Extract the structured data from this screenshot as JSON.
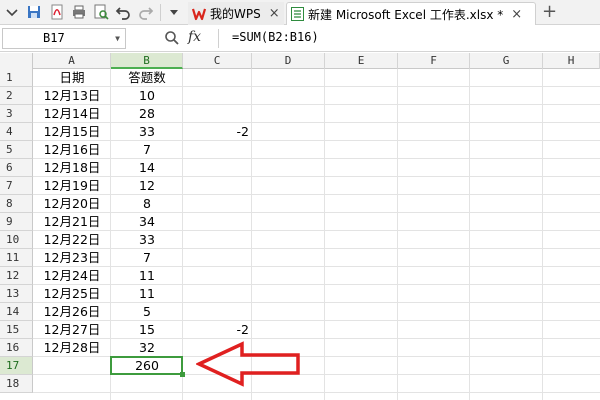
{
  "toolbar": {
    "icons": [
      "app-menu-icon",
      "save-icon",
      "pdf-export-icon",
      "print-icon",
      "print-preview-icon",
      "undo-icon",
      "redo-icon",
      "more-dropdown-icon"
    ]
  },
  "tabs": [
    {
      "label": "我的WPS",
      "close": "×",
      "icon": "wps-logo-icon"
    },
    {
      "label": "新建 Microsoft Excel 工作表.xlsx *",
      "close": "×",
      "icon": "spreadsheet-file-icon"
    }
  ],
  "new_tab": "+",
  "formula_bar": {
    "name_box": "B17",
    "fx_label": "fx",
    "formula": "=SUM(B2:B16)"
  },
  "columns": [
    "A",
    "B",
    "C",
    "D",
    "E",
    "F",
    "G",
    "H"
  ],
  "active_column": "B",
  "rows": [
    "1",
    "2",
    "3",
    "4",
    "5",
    "6",
    "7",
    "8",
    "9",
    "10",
    "11",
    "12",
    "13",
    "14",
    "15",
    "16",
    "17",
    "18"
  ],
  "active_row": "17",
  "sheet": {
    "A": [
      "日期",
      "12月13日",
      "12月14日",
      "12月15日",
      "12月16日",
      "12月18日",
      "12月19日",
      "12月20日",
      "12月21日",
      "12月22日",
      "12月23日",
      "12月24日",
      "12月25日",
      "12月26日",
      "12月27日",
      "12月28日",
      "",
      ""
    ],
    "B": [
      "答题数",
      "10",
      "28",
      "33",
      "7",
      "14",
      "12",
      "8",
      "34",
      "33",
      "7",
      "11",
      "11",
      "5",
      "15",
      "32",
      "260",
      ""
    ],
    "C": [
      "",
      "",
      "",
      "-2",
      "",
      "",
      "",
      "",
      "",
      "",
      "",
      "",
      "",
      "",
      "-2",
      "",
      "",
      ""
    ]
  },
  "selected_cell": "B17",
  "colors": {
    "selection": "#3d9b3d",
    "arrow": "#e02020",
    "header_bg": "#f3f3f3",
    "active_header_bg": "#dce9d2"
  }
}
